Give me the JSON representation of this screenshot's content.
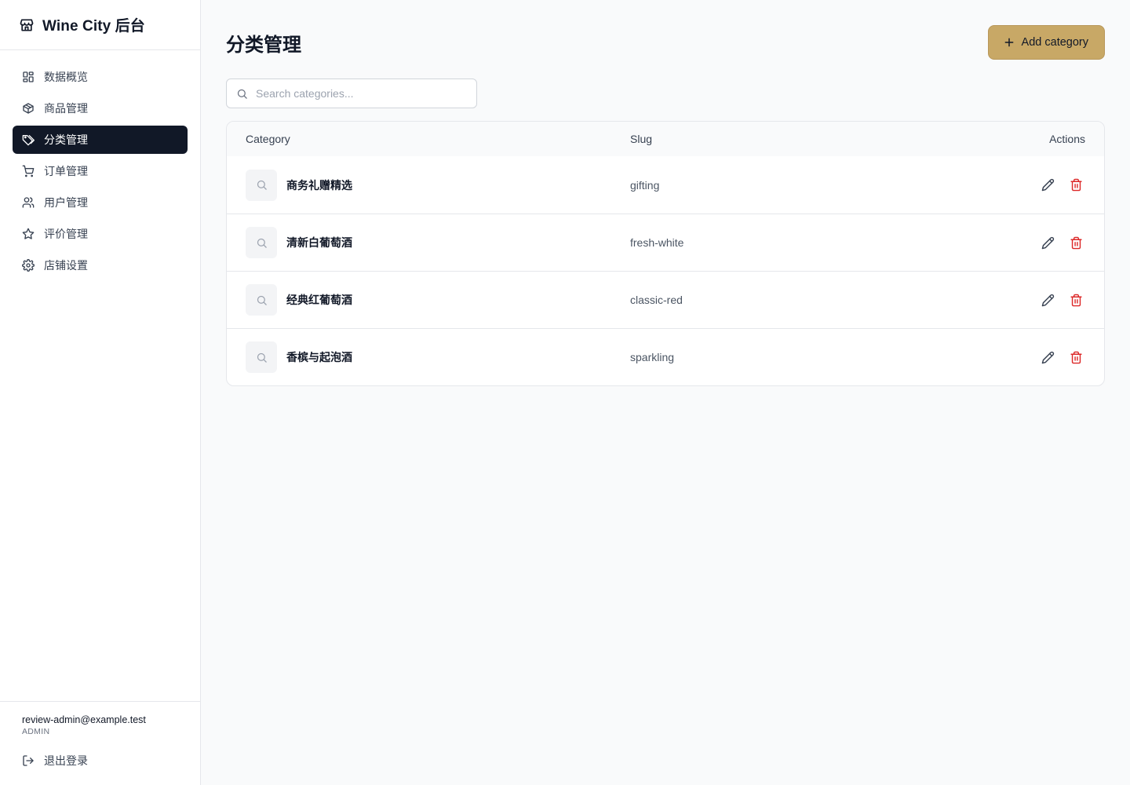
{
  "brand": {
    "title": "Wine City 后台",
    "icon": "store-icon"
  },
  "sidebar": {
    "items": [
      {
        "label": "数据概览",
        "icon": "dashboard-grid-icon",
        "active": false
      },
      {
        "label": "商品管理",
        "icon": "package-icon",
        "active": false
      },
      {
        "label": "分类管理",
        "icon": "tags-icon",
        "active": true
      },
      {
        "label": "订单管理",
        "icon": "cart-icon",
        "active": false
      },
      {
        "label": "用户管理",
        "icon": "users-icon",
        "active": false
      },
      {
        "label": "评价管理",
        "icon": "star-icon",
        "active": false
      },
      {
        "label": "店铺设置",
        "icon": "settings-icon",
        "active": false
      }
    ],
    "user": {
      "email": "review-admin@example.test",
      "role": "ADMIN"
    },
    "logout_label": "退出登录"
  },
  "main": {
    "title": "分类管理",
    "add_button_label": "Add category",
    "search": {
      "placeholder": "Search categories...",
      "value": ""
    },
    "table": {
      "columns": {
        "category": "Category",
        "slug": "Slug",
        "actions": "Actions"
      },
      "rows": [
        {
          "name": "商务礼赠精选",
          "slug": "gifting"
        },
        {
          "name": "清新白葡萄酒",
          "slug": "fresh-white"
        },
        {
          "name": "经典红葡萄酒",
          "slug": "classic-red"
        },
        {
          "name": "香槟与起泡酒",
          "slug": "sparkling"
        }
      ]
    }
  },
  "colors": {
    "accent": "#c8a866",
    "active_nav_bg": "#111827",
    "delete": "#dc2626"
  }
}
